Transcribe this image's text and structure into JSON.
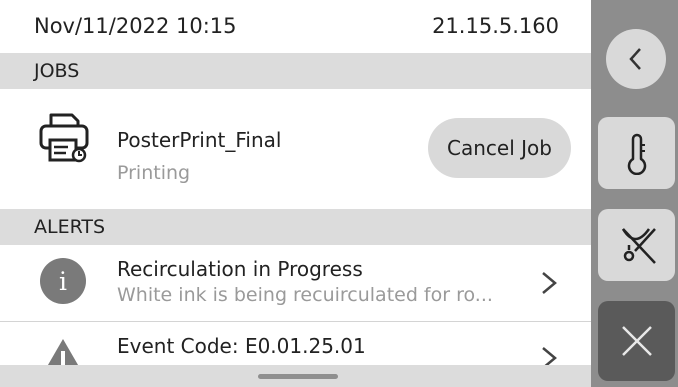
{
  "status_bar": {
    "datetime": "Nov/11/2022 10:15",
    "ip_address": "21.15.5.160"
  },
  "jobs": {
    "header": "JOBS",
    "job": {
      "name": "PosterPrint_Final",
      "status": "Printing",
      "cancel_label": "Cancel Job",
      "icon": "printer-icon"
    }
  },
  "alerts": {
    "header": "ALERTS",
    "items": [
      {
        "icon": "info-icon",
        "icon_glyph": "i",
        "title": "Recirculation in Progress",
        "subtitle": "White ink is being recuirculated for ro..."
      },
      {
        "icon": "warning-icon",
        "title": "Event Code: E0.01.25.01"
      }
    ]
  },
  "side_panel": {
    "buttons": [
      "back-icon",
      "thermometer-icon",
      "maintenance-icon",
      "close-icon"
    ]
  },
  "colors": {
    "section_header_bg": "#dcdcdc",
    "side_panel_bg": "#8d8d8d",
    "button_bg": "#d9d9d9",
    "close_button_bg": "#5a5a5a",
    "secondary_text": "#9a9a9a"
  }
}
